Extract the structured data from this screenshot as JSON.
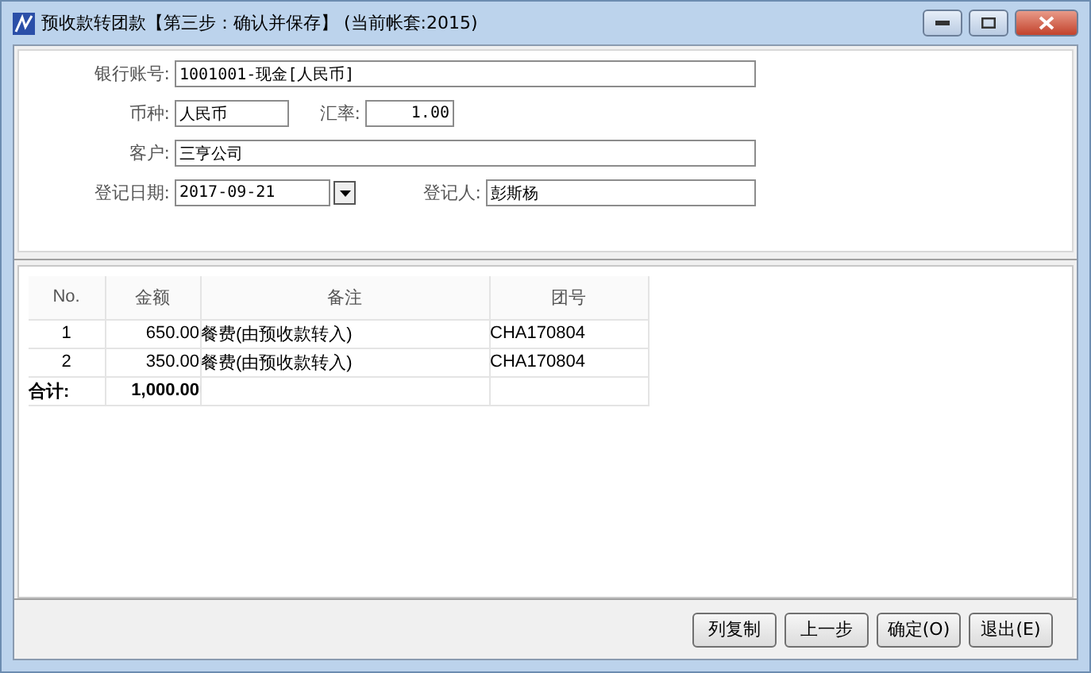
{
  "window": {
    "title": "预收款转团款【第三步：确认并保存】 (当前帐套:2015)"
  },
  "form": {
    "bank_account": {
      "label": "银行账号:",
      "value": "1001001-现金[人民币]"
    },
    "currency": {
      "label": "币种:",
      "value": "人民币"
    },
    "rate": {
      "label": "汇率:",
      "value": "1.00"
    },
    "customer": {
      "label": "客户:",
      "value": "三亨公司"
    },
    "date": {
      "label": "登记日期:",
      "value": "2017-09-21"
    },
    "registrar": {
      "label": "登记人:",
      "value": "彭斯杨"
    }
  },
  "table": {
    "columns": [
      "No.",
      "金额",
      "备注",
      "团号"
    ],
    "rows": [
      [
        "1",
        "650.00",
        "餐费(由预收款转入)",
        "CHA170804"
      ],
      [
        "2",
        "350.00",
        "餐费(由预收款转入)",
        "CHA170804"
      ]
    ],
    "total": {
      "label": "合计:",
      "amount": "1,000.00"
    }
  },
  "buttons": [
    "列复制",
    "上一步",
    "确定(O)",
    "退出(E)"
  ]
}
